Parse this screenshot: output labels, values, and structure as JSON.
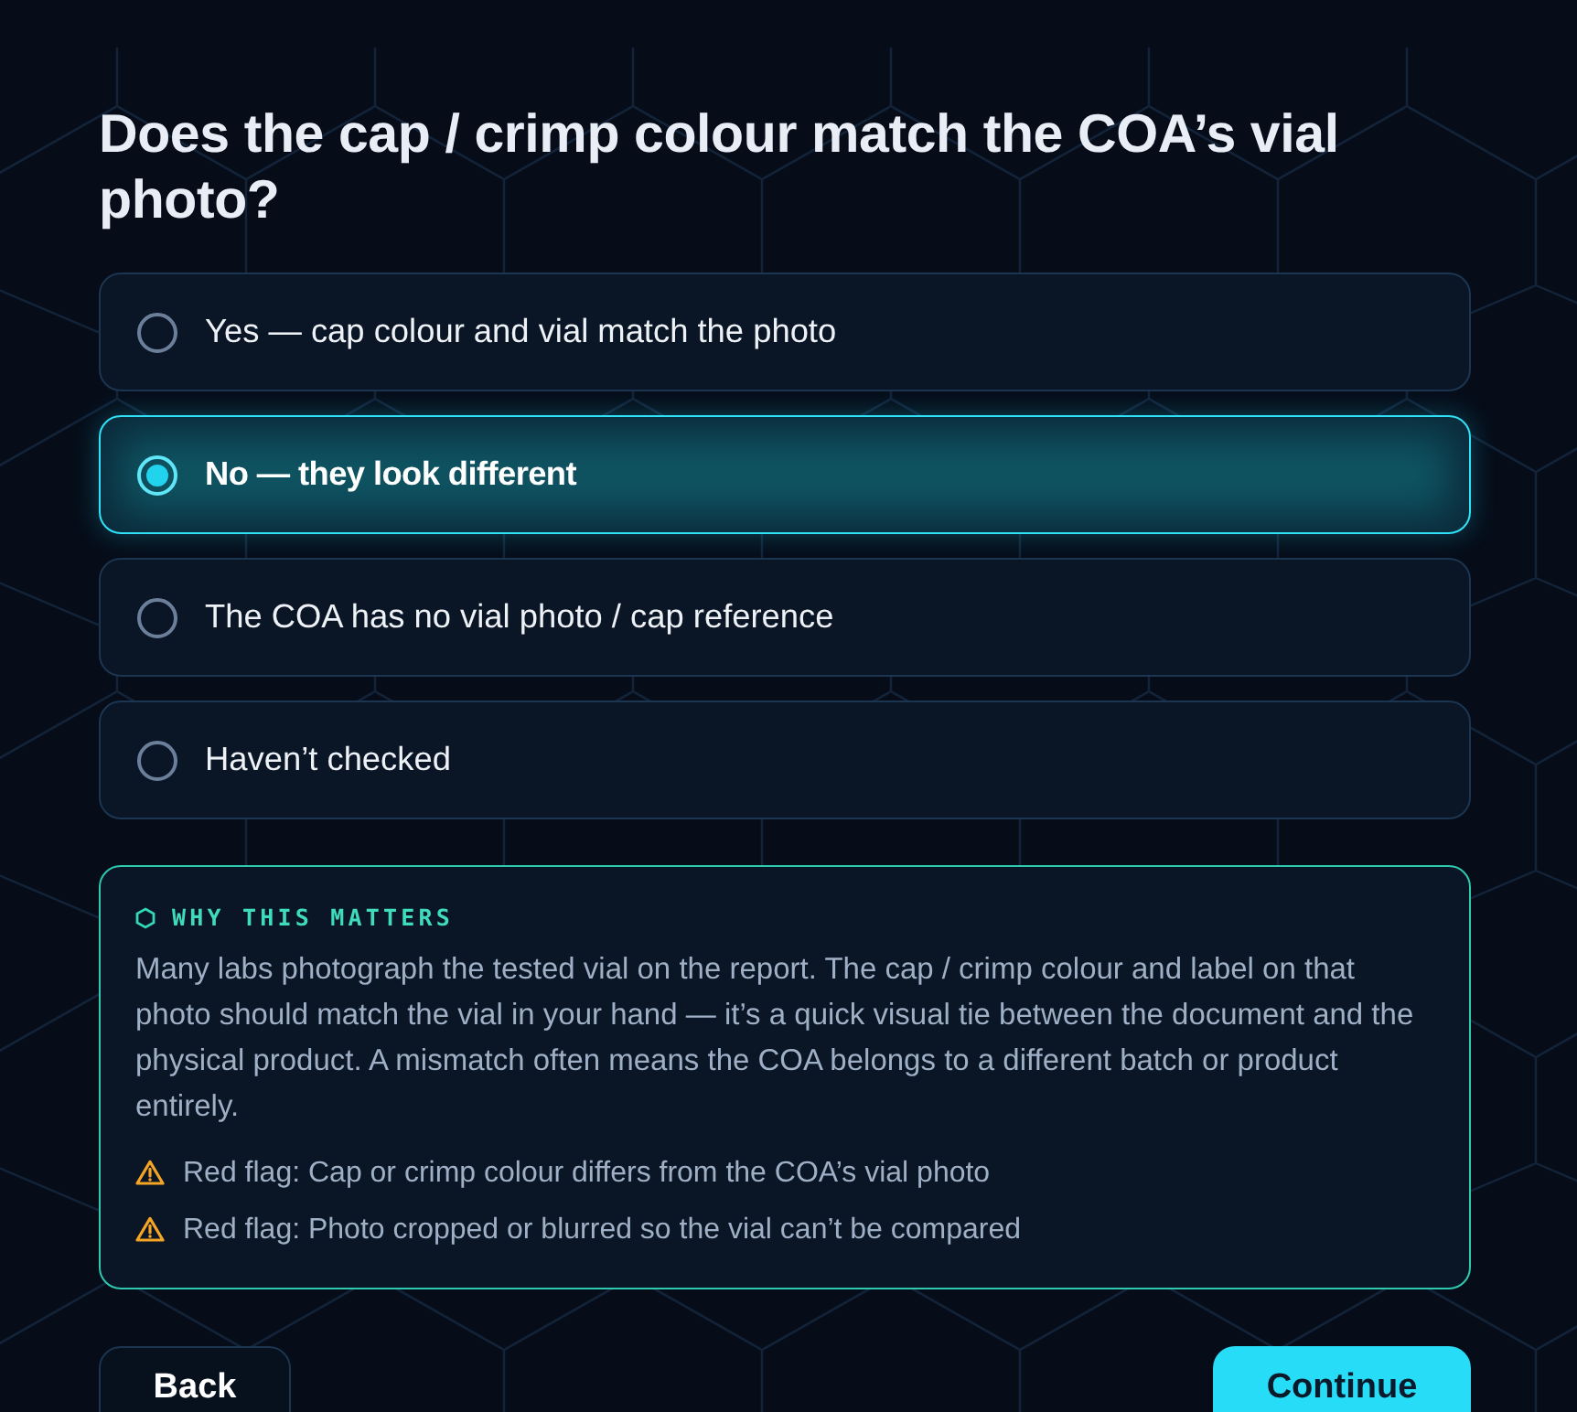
{
  "question": {
    "title": "Does the cap / crimp colour match the COA’s vial photo?"
  },
  "options": [
    {
      "label": "Yes — cap colour and vial match the photo",
      "selected": false
    },
    {
      "label": "No — they look different",
      "selected": true
    },
    {
      "label": "The COA has no vial photo / cap reference",
      "selected": false
    },
    {
      "label": "Haven’t checked",
      "selected": false
    }
  ],
  "info": {
    "heading": "WHY THIS MATTERS",
    "body": "Many labs photograph the tested vial on the report. The cap / crimp colour and label on that photo should match the vial in your hand — it’s a quick visual tie between the document and the physical product. A mismatch often means the COA belongs to a different batch or product entirely.",
    "red_flags": [
      "Red flag: Cap or crimp colour differs from the COA’s vial photo",
      "Red flag: Photo cropped or blurred so the vial can’t be compared"
    ]
  },
  "buttons": [
    {
      "label": "Back",
      "kind": "secondary"
    },
    {
      "label": "Continue",
      "kind": "primary"
    }
  ]
}
